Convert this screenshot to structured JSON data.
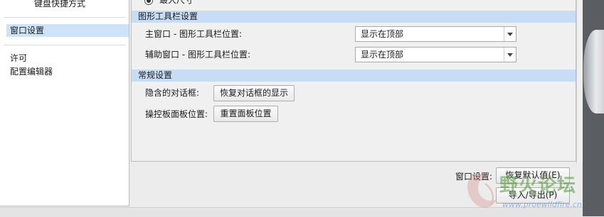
{
  "nav": {
    "item_shortcuts": "键盘快捷方式",
    "item_window_settings": "窗口设置",
    "item_license": "许可",
    "item_config_editor": "配置编辑器"
  },
  "partial_radio_label": "最大尺寸",
  "graphics_toolbar": {
    "header": "图形工具栏设置",
    "main_label": "主窗口 - 图形工具栏位置:",
    "main_value": "显示在顶部",
    "aux_label": "辅助窗口 - 图形工具栏位置:",
    "aux_value": "显示在顶部"
  },
  "general": {
    "header": "常规设置",
    "hidden_dialogs_label": "隐含的对话框:",
    "restore_dialogs_button": "恢复对话框的显示",
    "dashboard_position_label": "操控板面板位置:",
    "reset_panel_button": "重置面板位置"
  },
  "footer": {
    "window_settings_label": "窗口设置:",
    "restore_defaults_button": "恢复默认值(E)",
    "import_export_button": "导入/导出(P)"
  },
  "watermark": {
    "title": "野火论坛",
    "url": "www.proewildfire.cn"
  },
  "colors": {
    "section_header": "#c7dcf5",
    "nav_selected": "#cde3f7",
    "watermark_green": "#4f9a34"
  }
}
